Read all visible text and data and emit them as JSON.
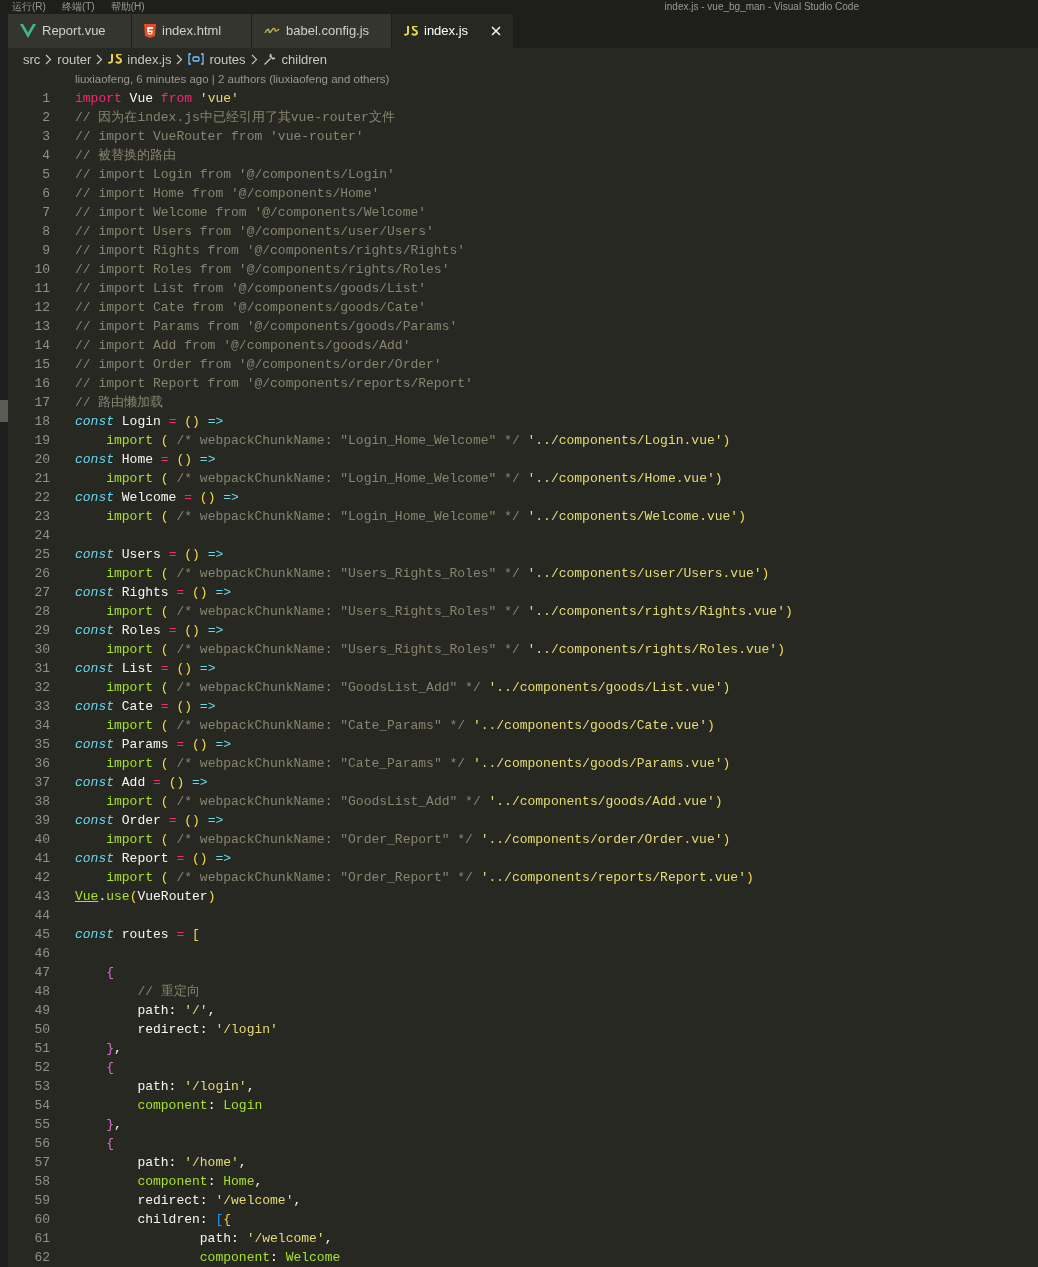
{
  "title_bar": {
    "menus": [
      "运行(R)",
      "终端(T)",
      "帮助(H)"
    ],
    "title": "index.js - vue_bg_man - Visual Studio Code"
  },
  "tabs": [
    {
      "label": "Report.vue",
      "kind": "vue",
      "selected": false
    },
    {
      "label": "index.html",
      "kind": "html",
      "selected": false
    },
    {
      "label": "babel.config.js",
      "kind": "babel",
      "selected": false
    },
    {
      "label": "index.js",
      "kind": "js",
      "selected": true
    }
  ],
  "breadcrumb": [
    {
      "label": "src",
      "kind": "folder"
    },
    {
      "label": "router",
      "kind": "folder"
    },
    {
      "label": "index.js",
      "kind": "js"
    },
    {
      "label": "routes",
      "kind": "variable"
    },
    {
      "label": "children",
      "kind": "property"
    }
  ],
  "codelens": "liuxiaofeng, 6 minutes ago | 2 authors (liuxiaofeng and others)",
  "lines": [
    {
      "n": "1",
      "tokens": [
        {
          "kind": "kw",
          "text": "import"
        },
        {
          "kind": "plain",
          "text": " Vue "
        },
        {
          "kind": "kw",
          "text": "from"
        },
        {
          "kind": "str",
          "text": " 'vue'"
        }
      ]
    },
    {
      "n": "2",
      "tokens": [
        {
          "kind": "comment",
          "text": "// 因为在index.js中已经引用了其vue-router文件"
        }
      ]
    },
    {
      "n": "3",
      "tokens": [
        {
          "kind": "comment",
          "text": "// import VueRouter from 'vue-router'"
        }
      ]
    },
    {
      "n": "4",
      "tokens": [
        {
          "kind": "comment",
          "text": "// 被替换的路由"
        }
      ]
    },
    {
      "n": "5",
      "tokens": [
        {
          "kind": "comment",
          "text": "// import Login from '@/components/Login'"
        }
      ]
    },
    {
      "n": "6",
      "tokens": [
        {
          "kind": "comment",
          "text": "// import Home from '@/components/Home'"
        }
      ]
    },
    {
      "n": "7",
      "tokens": [
        {
          "kind": "comment",
          "text": "// import Welcome from '@/components/Welcome'"
        }
      ]
    },
    {
      "n": "8",
      "tokens": [
        {
          "kind": "comment",
          "text": "// import Users from '@/components/user/Users'"
        }
      ]
    },
    {
      "n": "9",
      "tokens": [
        {
          "kind": "comment",
          "text": "// import Rights from '@/components/rights/Rights'"
        }
      ]
    },
    {
      "n": "10",
      "tokens": [
        {
          "kind": "comment",
          "text": "// import Roles from '@/components/rights/Roles'"
        }
      ]
    },
    {
      "n": "11",
      "tokens": [
        {
          "kind": "comment",
          "text": "// import List from '@/components/goods/List'"
        }
      ]
    },
    {
      "n": "12",
      "tokens": [
        {
          "kind": "comment",
          "text": "// import Cate from '@/components/goods/Cate'"
        }
      ]
    },
    {
      "n": "13",
      "tokens": [
        {
          "kind": "comment",
          "text": "// import Params from '@/components/goods/Params'"
        }
      ]
    },
    {
      "n": "14",
      "tokens": [
        {
          "kind": "comment",
          "text": "// import Add from '@/components/goods/Add'"
        }
      ]
    },
    {
      "n": "15",
      "tokens": [
        {
          "kind": "comment",
          "text": "// import Order from '@/components/order/Order'"
        }
      ]
    },
    {
      "n": "16",
      "tokens": [
        {
          "kind": "comment",
          "text": "// import Report from '@/components/reports/Report'"
        }
      ]
    },
    {
      "n": "17",
      "tokens": [
        {
          "kind": "comment",
          "text": "// 路由懒加载"
        }
      ]
    },
    {
      "n": "18",
      "tokens": [
        {
          "kind": "storage",
          "text": "const"
        },
        {
          "kind": "plain",
          "text": " Login "
        },
        {
          "kind": "op",
          "text": "= "
        },
        {
          "kind": "paren",
          "text": "() "
        },
        {
          "kind": "arrow",
          "text": "=>"
        }
      ]
    },
    {
      "n": "19",
      "tokens": [
        {
          "kind": "fn",
          "text": "    import "
        },
        {
          "kind": "paren",
          "text": "( "
        },
        {
          "kind": "comment",
          "text": "/* webpackChunkName: \"Login_Home_Welcome\" */ "
        },
        {
          "kind": "str",
          "text": "'../components/Login.vue'"
        },
        {
          "kind": "paren",
          "text": ")"
        }
      ]
    },
    {
      "n": "20",
      "tokens": [
        {
          "kind": "storage",
          "text": "const"
        },
        {
          "kind": "plain",
          "text": " Home "
        },
        {
          "kind": "op",
          "text": "= "
        },
        {
          "kind": "paren",
          "text": "() "
        },
        {
          "kind": "arrow",
          "text": "=>"
        }
      ]
    },
    {
      "n": "21",
      "tokens": [
        {
          "kind": "fn",
          "text": "    import "
        },
        {
          "kind": "paren",
          "text": "( "
        },
        {
          "kind": "comment",
          "text": "/* webpackChunkName: \"Login_Home_Welcome\" */ "
        },
        {
          "kind": "str",
          "text": "'../components/Home.vue'"
        },
        {
          "kind": "paren",
          "text": ")"
        }
      ]
    },
    {
      "n": "22",
      "tokens": [
        {
          "kind": "storage",
          "text": "const"
        },
        {
          "kind": "plain",
          "text": " Welcome "
        },
        {
          "kind": "op",
          "text": "= "
        },
        {
          "kind": "paren",
          "text": "() "
        },
        {
          "kind": "arrow",
          "text": "=>"
        }
      ]
    },
    {
      "n": "23",
      "tokens": [
        {
          "kind": "fn",
          "text": "    import "
        },
        {
          "kind": "paren",
          "text": "( "
        },
        {
          "kind": "comment",
          "text": "/* webpackChunkName: \"Login_Home_Welcome\" */ "
        },
        {
          "kind": "str",
          "text": "'../components/Welcome.vue'"
        },
        {
          "kind": "paren",
          "text": ")"
        }
      ]
    },
    {
      "n": "24"
    },
    {
      "n": "25",
      "tokens": [
        {
          "kind": "storage",
          "text": "const"
        },
        {
          "kind": "plain",
          "text": " Users "
        },
        {
          "kind": "op",
          "text": "= "
        },
        {
          "kind": "paren",
          "text": "() "
        },
        {
          "kind": "arrow",
          "text": "=>"
        }
      ]
    },
    {
      "n": "26",
      "tokens": [
        {
          "kind": "fn",
          "text": "    import "
        },
        {
          "kind": "paren",
          "text": "( "
        },
        {
          "kind": "comment",
          "text": "/* webpackChunkName: \"Users_Rights_Roles\" */ "
        },
        {
          "kind": "str",
          "text": "'../components/user/Users.vue'"
        },
        {
          "kind": "paren",
          "text": ")"
        }
      ]
    },
    {
      "n": "27",
      "tokens": [
        {
          "kind": "storage",
          "text": "const"
        },
        {
          "kind": "plain",
          "text": " Rights "
        },
        {
          "kind": "op",
          "text": "= "
        },
        {
          "kind": "paren",
          "text": "() "
        },
        {
          "kind": "arrow",
          "text": "=>"
        }
      ]
    },
    {
      "n": "28",
      "tokens": [
        {
          "kind": "fn",
          "text": "    import "
        },
        {
          "kind": "paren",
          "text": "( "
        },
        {
          "kind": "comment",
          "text": "/* webpackChunkName: \"Users_Rights_Roles\" */ "
        },
        {
          "kind": "str",
          "text": "'../components/rights/Rights.vue'"
        },
        {
          "kind": "paren",
          "text": ")"
        }
      ]
    },
    {
      "n": "29",
      "tokens": [
        {
          "kind": "storage",
          "text": "const"
        },
        {
          "kind": "plain",
          "text": " Roles "
        },
        {
          "kind": "op",
          "text": "= "
        },
        {
          "kind": "paren",
          "text": "() "
        },
        {
          "kind": "arrow",
          "text": "=>"
        }
      ]
    },
    {
      "n": "30",
      "tokens": [
        {
          "kind": "fn",
          "text": "    import "
        },
        {
          "kind": "paren",
          "text": "( "
        },
        {
          "kind": "comment",
          "text": "/* webpackChunkName: \"Users_Rights_Roles\" */ "
        },
        {
          "kind": "str",
          "text": "'../components/rights/Roles.vue'"
        },
        {
          "kind": "paren",
          "text": ")"
        }
      ]
    },
    {
      "n": "31",
      "tokens": [
        {
          "kind": "storage",
          "text": "const"
        },
        {
          "kind": "plain",
          "text": " List "
        },
        {
          "kind": "op",
          "text": "= "
        },
        {
          "kind": "paren",
          "text": "() "
        },
        {
          "kind": "arrow",
          "text": "=>"
        }
      ]
    },
    {
      "n": "32",
      "tokens": [
        {
          "kind": "fn",
          "text": "    import "
        },
        {
          "kind": "paren",
          "text": "( "
        },
        {
          "kind": "comment",
          "text": "/* webpackChunkName: \"GoodsList_Add\" */ "
        },
        {
          "kind": "str",
          "text": "'../components/goods/List.vue'"
        },
        {
          "kind": "paren",
          "text": ")"
        }
      ]
    },
    {
      "n": "33",
      "tokens": [
        {
          "kind": "storage",
          "text": "const"
        },
        {
          "kind": "plain",
          "text": " Cate "
        },
        {
          "kind": "op",
          "text": "= "
        },
        {
          "kind": "paren",
          "text": "() "
        },
        {
          "kind": "arrow",
          "text": "=>"
        }
      ]
    },
    {
      "n": "34",
      "tokens": [
        {
          "kind": "fn",
          "text": "    import "
        },
        {
          "kind": "paren",
          "text": "( "
        },
        {
          "kind": "comment",
          "text": "/* webpackChunkName: \"Cate_Params\" */ "
        },
        {
          "kind": "str",
          "text": "'../components/goods/Cate.vue'"
        },
        {
          "kind": "paren",
          "text": ")"
        }
      ]
    },
    {
      "n": "35",
      "tokens": [
        {
          "kind": "storage",
          "text": "const"
        },
        {
          "kind": "plain",
          "text": " Params "
        },
        {
          "kind": "op",
          "text": "= "
        },
        {
          "kind": "paren",
          "text": "() "
        },
        {
          "kind": "arrow",
          "text": "=>"
        }
      ]
    },
    {
      "n": "36",
      "tokens": [
        {
          "kind": "fn",
          "text": "    import "
        },
        {
          "kind": "paren",
          "text": "( "
        },
        {
          "kind": "comment",
          "text": "/* webpackChunkName: \"Cate_Params\" */ "
        },
        {
          "kind": "str",
          "text": "'../components/goods/Params.vue'"
        },
        {
          "kind": "paren",
          "text": ")"
        }
      ]
    },
    {
      "n": "37",
      "tokens": [
        {
          "kind": "storage",
          "text": "const"
        },
        {
          "kind": "plain",
          "text": " Add "
        },
        {
          "kind": "op",
          "text": "= "
        },
        {
          "kind": "paren",
          "text": "() "
        },
        {
          "kind": "arrow",
          "text": "=>"
        }
      ]
    },
    {
      "n": "38",
      "tokens": [
        {
          "kind": "fn",
          "text": "    import "
        },
        {
          "kind": "paren",
          "text": "( "
        },
        {
          "kind": "comment",
          "text": "/* webpackChunkName: \"GoodsList_Add\" */ "
        },
        {
          "kind": "str",
          "text": "'../components/goods/Add.vue'"
        },
        {
          "kind": "paren",
          "text": ")"
        }
      ]
    },
    {
      "n": "39",
      "tokens": [
        {
          "kind": "storage",
          "text": "const"
        },
        {
          "kind": "plain",
          "text": " Order "
        },
        {
          "kind": "op",
          "text": "= "
        },
        {
          "kind": "paren",
          "text": "() "
        },
        {
          "kind": "arrow",
          "text": "=>"
        }
      ]
    },
    {
      "n": "40",
      "tokens": [
        {
          "kind": "fn",
          "text": "    import "
        },
        {
          "kind": "paren",
          "text": "( "
        },
        {
          "kind": "comment",
          "text": "/* webpackChunkName: \"Order_Report\" */ "
        },
        {
          "kind": "str",
          "text": "'../components/order/Order.vue'"
        },
        {
          "kind": "paren",
          "text": ")"
        }
      ]
    },
    {
      "n": "41",
      "tokens": [
        {
          "kind": "storage",
          "text": "const"
        },
        {
          "kind": "plain",
          "text": " Report "
        },
        {
          "kind": "op",
          "text": "= "
        },
        {
          "kind": "paren",
          "text": "() "
        },
        {
          "kind": "arrow",
          "text": "=>"
        }
      ]
    },
    {
      "n": "42",
      "tokens": [
        {
          "kind": "fn",
          "text": "    import "
        },
        {
          "kind": "paren",
          "text": "( "
        },
        {
          "kind": "comment",
          "text": "/* webpackChunkName: \"Order_Report\" */ "
        },
        {
          "kind": "str",
          "text": "'../components/reports/Report.vue'"
        },
        {
          "kind": "paren",
          "text": ")"
        }
      ]
    },
    {
      "n": "43",
      "tokens": [
        {
          "kind": "fn_underlined",
          "text": "Vue"
        },
        {
          "kind": "plain",
          "text": "."
        },
        {
          "kind": "fn",
          "text": "use"
        },
        {
          "kind": "paren",
          "text": "("
        },
        {
          "kind": "plain",
          "text": "VueRouter"
        },
        {
          "kind": "paren",
          "text": ")"
        }
      ]
    },
    {
      "n": "44"
    },
    {
      "n": "45",
      "tokens": [
        {
          "kind": "storage",
          "text": "const"
        },
        {
          "kind": "plain",
          "text": " routes "
        },
        {
          "kind": "op",
          "text": "= "
        },
        {
          "kind": "paren",
          "text": "["
        }
      ]
    },
    {
      "n": "46"
    },
    {
      "n": "47",
      "tokens": [
        {
          "kind": "brace",
          "text": "    {"
        }
      ]
    },
    {
      "n": "48",
      "tokens": [
        {
          "kind": "comment",
          "text": "        // 重定向"
        }
      ]
    },
    {
      "n": "49",
      "tokens": [
        {
          "kind": "plain",
          "text": "        path: "
        },
        {
          "kind": "str",
          "text": "'/'"
        },
        {
          "kind": "plain",
          "text": ","
        }
      ]
    },
    {
      "n": "50",
      "tokens": [
        {
          "kind": "plain",
          "text": "        redirect: "
        },
        {
          "kind": "str",
          "text": "'/login'"
        }
      ]
    },
    {
      "n": "51",
      "tokens": [
        {
          "kind": "brace",
          "text": "    }"
        },
        {
          "kind": "plain",
          "text": ","
        }
      ]
    },
    {
      "n": "52",
      "tokens": [
        {
          "kind": "brace",
          "text": "    {"
        }
      ]
    },
    {
      "n": "53",
      "tokens": [
        {
          "kind": "plain",
          "text": "        path: "
        },
        {
          "kind": "str",
          "text": "'/login'"
        },
        {
          "kind": "plain",
          "text": ","
        }
      ]
    },
    {
      "n": "54",
      "tokens": [
        {
          "kind": "fn",
          "text": "        component"
        },
        {
          "kind": "plain",
          "text": ": "
        },
        {
          "kind": "fn",
          "text": "Login"
        }
      ]
    },
    {
      "n": "55",
      "tokens": [
        {
          "kind": "brace",
          "text": "    }"
        },
        {
          "kind": "plain",
          "text": ","
        }
      ]
    },
    {
      "n": "56",
      "tokens": [
        {
          "kind": "brace",
          "text": "    {"
        }
      ]
    },
    {
      "n": "57",
      "tokens": [
        {
          "kind": "plain",
          "text": "        path: "
        },
        {
          "kind": "str",
          "text": "'/home'"
        },
        {
          "kind": "plain",
          "text": ","
        }
      ]
    },
    {
      "n": "58",
      "tokens": [
        {
          "kind": "fn",
          "text": "        component"
        },
        {
          "kind": "plain",
          "text": ": "
        },
        {
          "kind": "fn",
          "text": "Home"
        },
        {
          "kind": "plain",
          "text": ","
        }
      ]
    },
    {
      "n": "59",
      "tokens": [
        {
          "kind": "plain",
          "text": "        redirect: "
        },
        {
          "kind": "str",
          "text": "'/welcome'"
        },
        {
          "kind": "plain",
          "text": ","
        }
      ]
    },
    {
      "n": "60",
      "tokens": [
        {
          "kind": "plain",
          "text": "        children: "
        },
        {
          "kind": "bracket",
          "text": "["
        },
        {
          "kind": "paren",
          "text": "{"
        }
      ]
    },
    {
      "n": "61",
      "tokens": [
        {
          "kind": "plain",
          "text": "                path: "
        },
        {
          "kind": "str",
          "text": "'/welcome'"
        },
        {
          "kind": "plain",
          "text": ","
        }
      ]
    },
    {
      "n": "62",
      "tokens": [
        {
          "kind": "fn",
          "text": "                component"
        },
        {
          "kind": "plain",
          "text": ": "
        },
        {
          "kind": "fn",
          "text": "Welcome"
        }
      ]
    }
  ]
}
